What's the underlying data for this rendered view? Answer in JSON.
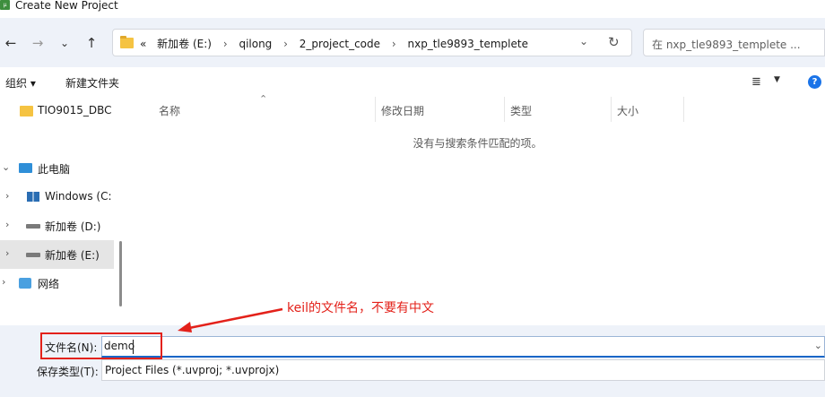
{
  "window": {
    "title": "Create New Project"
  },
  "navigation": {
    "back_icon": "←",
    "forward_icon": "→",
    "history_icon": "⌄",
    "up_icon": "↑",
    "breadcrumbs": [
      "«",
      "新加卷 (E:)",
      "qilong",
      "2_project_code",
      "nxp_tle9893_templete"
    ],
    "search_placeholder": "在 nxp_tle9893_templete ..."
  },
  "toolbar": {
    "organize_label": "组织 ▾",
    "new_folder_label": "新建文件夹",
    "view_icon": "≣",
    "view_dropdown_icon": "▼",
    "help_icon": "?"
  },
  "sidebar": {
    "items": [
      {
        "label": "TIO9015_DBC",
        "icon": "folder-icon"
      },
      {
        "label": "此电脑",
        "icon": "computer-icon"
      },
      {
        "label": "Windows  (C:",
        "icon": "windows-drive-icon"
      },
      {
        "label": "新加卷 (D:)",
        "icon": "drive-icon"
      },
      {
        "label": "新加卷 (E:)",
        "icon": "drive-icon"
      },
      {
        "label": "网络",
        "icon": "network-icon"
      }
    ]
  },
  "file_list": {
    "columns": [
      "名称",
      "修改日期",
      "类型",
      "大小"
    ],
    "empty_message": "没有与搜索条件匹配的项。"
  },
  "form": {
    "filename_label": "文件名(N):",
    "filename_value": "demo",
    "filetype_label": "保存类型(T):",
    "filetype_value": "Project Files (*.uvproj; *.uvprojx)"
  },
  "annotation": {
    "text": "keil的文件名，不要有中文",
    "color": "#e3211a"
  }
}
